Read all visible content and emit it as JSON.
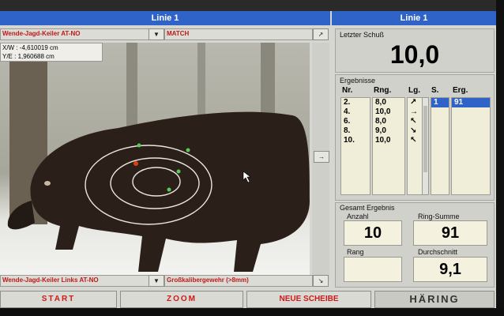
{
  "header": {
    "title_left": "Linie 1",
    "title_right": "Linie 1"
  },
  "target_select": {
    "value": "Wende-Jagd-Keiler AT-NO",
    "arrow": "▼"
  },
  "mode": {
    "value": "MATCH",
    "arrow": "↗"
  },
  "coords": {
    "xw": "X/W : -4,610019 cm",
    "ye": "Y/E : 1,960688 cm"
  },
  "last_shot": {
    "label": "Letzter Schuß",
    "value": "10,0"
  },
  "results": {
    "label": "Ergebnisse",
    "headers": {
      "nr": "Nr.",
      "rng": "Rng.",
      "lg": "Lg.",
      "s": "S.",
      "erg": "Erg."
    },
    "rows": [
      {
        "nr": "2.",
        "rng": "8,0",
        "lg": "↗"
      },
      {
        "nr": "4.",
        "rng": "10,0",
        "lg": "→"
      },
      {
        "nr": "6.",
        "rng": "8,0",
        "lg": "↖"
      },
      {
        "nr": "8.",
        "rng": "9,0",
        "lg": "↘"
      },
      {
        "nr": "10.",
        "rng": "10,0",
        "lg": "↖"
      }
    ],
    "series": [
      {
        "s": "1",
        "erg": "91"
      }
    ]
  },
  "total": {
    "label": "Gesamt Ergebnis",
    "anzahl_label": "Anzahl",
    "anzahl": "10",
    "ring_summe_label": "Ring-Summe",
    "ring_summe": "91",
    "rang_label": "Rang",
    "rang": "",
    "durchschnitt_label": "Durchschnitt",
    "durchschnitt": "9,1"
  },
  "bottom_target": {
    "value": "Wende-Jagd-Keiler Links AT-NO",
    "arrow": "▼"
  },
  "weapon": {
    "value": "Großkalibergewehr (>8mm)",
    "arrow": "↘"
  },
  "side_arrow": "→",
  "buttons": {
    "start": "START",
    "zoom": "ZOOM",
    "new_target": "NEUE SCHEIBE"
  },
  "logo": "HÄRING"
}
